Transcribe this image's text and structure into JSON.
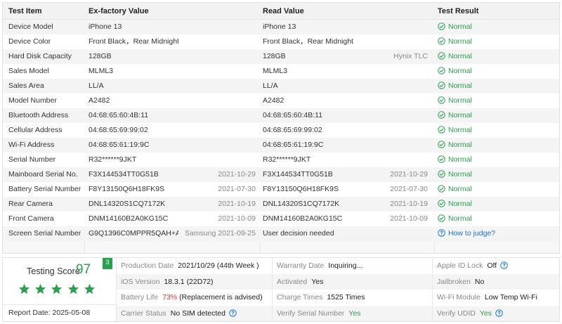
{
  "table": {
    "headers": {
      "item": "Test Item",
      "factory": "Ex-factory Value",
      "read": "Read Value",
      "result": "Test Result"
    },
    "rows": [
      {
        "item": "Device Model",
        "factory": "iPhone 13",
        "factory_extra": "",
        "read": "iPhone 13",
        "read_extra": "",
        "result": "Normal",
        "status": "ok"
      },
      {
        "item": "Device Color",
        "factory": "Front Black，Rear Midnight",
        "factory_extra": "",
        "read": "Front Black，Rear Midnight",
        "read_extra": "",
        "result": "Normal",
        "status": "ok"
      },
      {
        "item": "Hard Disk Capacity",
        "factory": "128GB",
        "factory_extra": "",
        "read": "128GB",
        "read_extra": "Hynix TLC",
        "result": "Normal",
        "status": "ok"
      },
      {
        "item": "Sales Model",
        "factory": "MLML3",
        "factory_extra": "",
        "read": "MLML3",
        "read_extra": "",
        "result": "Normal",
        "status": "ok"
      },
      {
        "item": "Sales Area",
        "factory": "LL/A",
        "factory_extra": "",
        "read": "LL/A",
        "read_extra": "",
        "result": "Normal",
        "status": "ok"
      },
      {
        "item": "Model Number",
        "factory": "A2482",
        "factory_extra": "",
        "read": "A2482",
        "read_extra": "",
        "result": "Normal",
        "status": "ok"
      },
      {
        "item": "Bluetooth Address",
        "factory": "04:68:65:60:4B:11",
        "factory_extra": "",
        "read": "04:68:65:60:4B:11",
        "read_extra": "",
        "result": "Normal",
        "status": "ok"
      },
      {
        "item": "Cellular Address",
        "factory": "04:68:65:69:99:02",
        "factory_extra": "",
        "read": "04:68:65:69:99:02",
        "read_extra": "",
        "result": "Normal",
        "status": "ok"
      },
      {
        "item": "Wi-Fi Address",
        "factory": "04:68:65:61:19:9C",
        "factory_extra": "",
        "read": "04:68:65:61:19:9C",
        "read_extra": "",
        "result": "Normal",
        "status": "ok"
      },
      {
        "item": "Serial Number",
        "factory": "R32******9JKT",
        "factory_extra": "",
        "read": "R32******9JKT",
        "read_extra": "",
        "result": "Normal",
        "status": "ok"
      },
      {
        "item": "Mainboard Serial No.",
        "factory": "F3X144534TT0G51B",
        "factory_extra": "2021-10-29",
        "read": "F3X144534TT0G51B",
        "read_extra": "2021-10-29",
        "result": "Normal",
        "status": "ok"
      },
      {
        "item": "Battery Serial Number",
        "factory": "F8Y13150Q6H18FK9S",
        "factory_extra": "2021-07-30",
        "read": "F8Y13150Q6H18FK9S",
        "read_extra": "2021-07-30",
        "result": "Normal",
        "status": "ok"
      },
      {
        "item": "Rear Camera",
        "factory": "DNL14320S1CQ7172K",
        "factory_extra": "2021-10-19",
        "read": "DNL14320S1CQ7172K",
        "read_extra": "2021-10-19",
        "result": "Normal",
        "status": "ok"
      },
      {
        "item": "Front Camera",
        "factory": "DNM14160B2A0KG15C",
        "factory_extra": "2021-10-09",
        "read": "DNM14160B2A0KG15C",
        "read_extra": "2021-10-09",
        "result": "Normal",
        "status": "ok"
      },
      {
        "item": "Screen Serial Number",
        "factory": "G9Q1396C0MPPR5QAH+A20...",
        "factory_extra": "Samsung 2021-09-25",
        "read": "User decision needed",
        "read_extra": "",
        "result": "How to judge?",
        "status": "help"
      }
    ]
  },
  "summary": {
    "score_label": "Testing Score",
    "score": "97",
    "score_badge": "3",
    "stars": 5,
    "report_label": "Report Date:",
    "report_date": "2025-05-08",
    "col1": [
      {
        "k": "Production Date",
        "v": "2021/10/29 (44th Week )"
      },
      {
        "k": "iOS Version",
        "v": "18.3.1 (22D72)"
      },
      {
        "k": "Battery Life",
        "v_red": "73%",
        "v": "(Replacement is advised)"
      },
      {
        "k": "Carrier Status",
        "v": "No SIM detected"
      }
    ],
    "col2": [
      {
        "k": "Warranty Date",
        "v": "Inquiring..."
      },
      {
        "k": "Activated",
        "v": "Yes"
      },
      {
        "k": "Charge Times",
        "v": "1525 Times"
      },
      {
        "k": "Verify Serial Number",
        "v": "Yes"
      }
    ],
    "col3": [
      {
        "k": "Apple ID Lock",
        "v": "Off"
      },
      {
        "k": "Jailbroken",
        "v": "No"
      },
      {
        "k": "Wi-Fi Module",
        "v": "Low Temp Wi-Fi"
      },
      {
        "k": "Verify UDID",
        "v": "Yes"
      }
    ]
  },
  "colors": {
    "ok": "#2aa14e",
    "link": "#1a73d9",
    "warn": "#e53935"
  },
  "icons": {
    "ok": "check-circle-icon",
    "help": "question-circle-icon",
    "star": "star-icon"
  }
}
